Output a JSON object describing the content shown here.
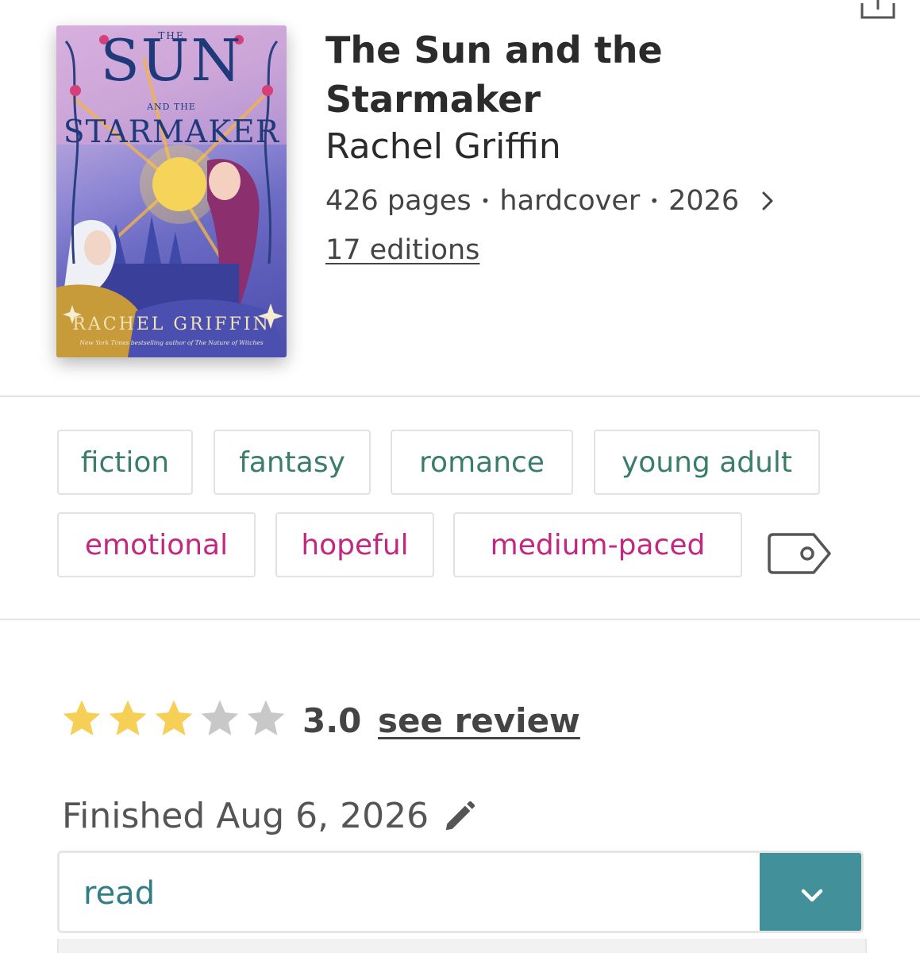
{
  "book": {
    "title": "The Sun and the Starmaker",
    "author": "Rachel Griffin",
    "pages": "426 pages",
    "format": "hardcover",
    "year": "2026",
    "editions": "17 editions"
  },
  "cover": {
    "the": "THE",
    "sun": "SUN",
    "and_the": "AND THE",
    "starmaker": "STARMAKER",
    "author": "RACHEL GRIFFIN",
    "tagline": "New York Times bestselling author of The Nature of Witches"
  },
  "tags": {
    "genres": [
      "fiction",
      "fantasy",
      "romance",
      "young adult"
    ],
    "moods": [
      "emotional",
      "hopeful",
      "medium-paced"
    ]
  },
  "rating": {
    "value": "3.0",
    "stars": 3,
    "max": 5,
    "see_review": "see review"
  },
  "finished": "Finished Aug 6, 2026",
  "status": {
    "selected": "read"
  },
  "colors": {
    "genre_tag": "#3a7d6a",
    "mood_tag": "#c2287f",
    "star_filled": "#f6cf57",
    "star_empty": "#c8c8c8",
    "accent": "#42909a"
  },
  "icons": {
    "share": "share-icon",
    "chevron_right": "chevron-right-icon",
    "tag": "tag-icon",
    "pencil": "pencil-icon",
    "chevron_down": "chevron-down-icon"
  }
}
